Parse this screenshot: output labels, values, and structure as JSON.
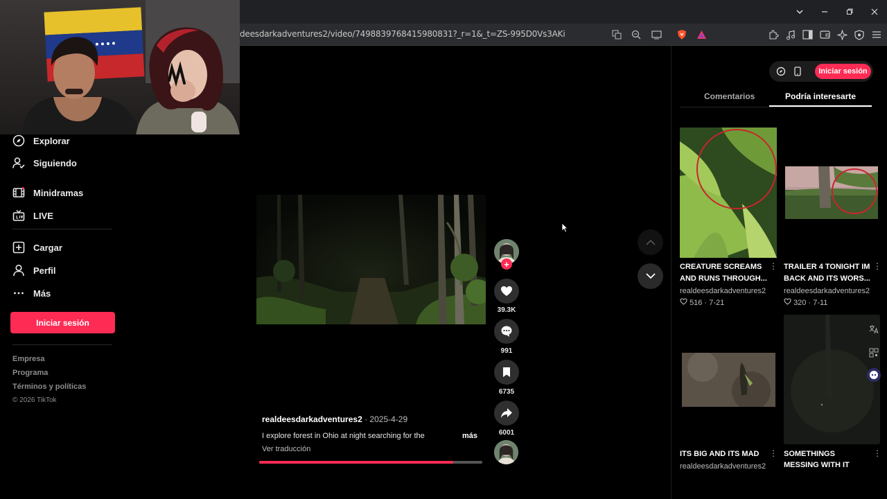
{
  "browser": {
    "url": "deesdarkadventures2/video/7498839768415980831?_r=1&_t=ZS-995D0Vs3AKi",
    "window_controls": [
      "chevron-down",
      "minimize",
      "restore",
      "close"
    ]
  },
  "sidebar": {
    "items": [
      {
        "label": "Explorar",
        "icon": "compass-icon"
      },
      {
        "label": "Siguiendo",
        "icon": "following-icon"
      },
      {
        "label": "Minidramas",
        "icon": "film-icon"
      },
      {
        "label": "LIVE",
        "icon": "live-tv-icon"
      },
      {
        "label": "Cargar",
        "icon": "upload-plus-icon"
      },
      {
        "label": "Perfil",
        "icon": "person-icon"
      },
      {
        "label": "Más",
        "icon": "ellipsis-icon"
      }
    ],
    "login_label": "Iniciar sesión",
    "footer": [
      "Empresa",
      "Programa",
      "Términos y políticas"
    ],
    "copyright": "© 2026 TikTok"
  },
  "video": {
    "author": "realdeesdarkadventures2",
    "date": "· 2025-4-29",
    "description": "I explore forest in Ohio at night searching for the",
    "more_label": "más",
    "translate_label": "Ver traducción",
    "progress": 0.87
  },
  "actions": {
    "likes": "39.3K",
    "comments": "991",
    "saves": "6735",
    "shares": "6001"
  },
  "right_panel": {
    "login_label": "Iniciar sesión",
    "tabs": [
      "Comentarios",
      "Podría interesarte"
    ],
    "active_tab": 1,
    "cards": [
      {
        "title1": "CREATURE SCREAMS",
        "title2": "AND RUNS THROUGH...",
        "author": "realdeesdarkadventures2",
        "likes": "516",
        "date": "· 7-21"
      },
      {
        "title1": "TRAILER 4 TONIGHT IM",
        "title2": "BACK AND ITS WORS...",
        "author": "realdeesdarkadventures2",
        "likes": "320",
        "date": "· 7-11"
      },
      {
        "title1": "ITS BIG AND ITS MAD",
        "author": "realdeesdarkadventures2"
      },
      {
        "title1": "SOMETHINGS",
        "title2": "MESSING WITH IT"
      }
    ]
  },
  "colors": {
    "accent": "#fe2c55",
    "background": "#000000"
  }
}
